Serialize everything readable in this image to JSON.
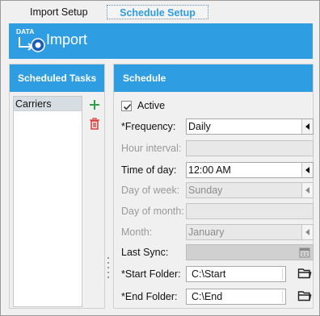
{
  "tabs": [
    {
      "label": "Import Setup"
    },
    {
      "label": "Schedule Setup"
    }
  ],
  "header": {
    "logo_text": "DATA",
    "title": "Import",
    "logo_icon": "data-import-logo"
  },
  "left_panel": {
    "title": "Scheduled Tasks",
    "items": [
      {
        "label": "Carriers"
      }
    ],
    "add_icon": "plus-icon",
    "delete_icon": "trash-icon"
  },
  "schedule": {
    "title": "Schedule",
    "active_label": "Active",
    "active_checked": true,
    "frequency": {
      "label": "*Frequency:",
      "value": "Daily"
    },
    "hour_interval": {
      "label": "Hour interval:",
      "value": ""
    },
    "time_of_day": {
      "label": "Time of day:",
      "value": "12:00 AM"
    },
    "day_of_week": {
      "label": "Day of week:",
      "value": "Sunday"
    },
    "day_of_month": {
      "label": "Day of month:",
      "value": ""
    },
    "month": {
      "label": "Month:",
      "value": "January"
    },
    "last_sync": {
      "label": "Last Sync:",
      "value": ""
    },
    "start_folder": {
      "label": "*Start Folder:",
      "value": "C:\\Start"
    },
    "end_folder": {
      "label": "*End Folder:",
      "value": "C:\\End"
    }
  },
  "colors": {
    "accent": "#2e9de2",
    "active_tab": "#2e9ce0",
    "add": "#2f9e44",
    "delete": "#d9383a"
  }
}
